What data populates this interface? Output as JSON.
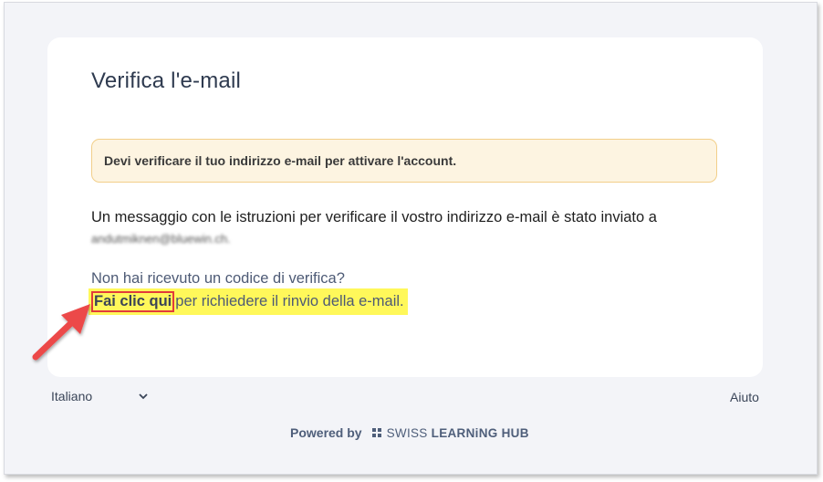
{
  "card": {
    "title": "Verifica l'e-mail",
    "warning": "Devi verificare il tuo indirizzo e-mail per attivare l'account.",
    "message": "Un messaggio con le istruzioni per verificare il vostro indirizzo e-mail è stato inviato a",
    "email": "andutmiknen@bluewin.ch.",
    "question": "Non hai ricevuto un codice di verifica?",
    "click_here": "Fai clic qui",
    "resend_text": "per richiedere il rinvio della e-mail."
  },
  "footer": {
    "language": "Italiano",
    "help": "Aiuto",
    "powered_by": "Powered by",
    "brand_prefix": "SWISS ",
    "brand_main": "LEARNiNG HUB"
  },
  "colors": {
    "highlight": "#fff85a",
    "annotation_red": "#e23b3b",
    "warning_bg": "#fdf4e1"
  }
}
